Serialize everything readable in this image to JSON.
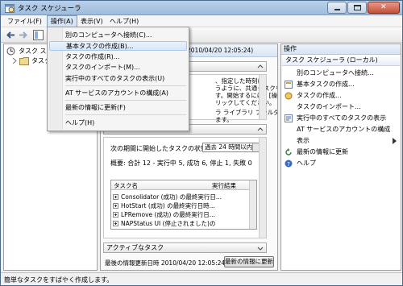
{
  "window": {
    "title": "タスク スケジューラ"
  },
  "menubar": {
    "items": [
      {
        "label": "ファイル(F)"
      },
      {
        "label": "操作(A)"
      },
      {
        "label": "表示(V)"
      },
      {
        "label": "ヘルプ(H)"
      }
    ]
  },
  "dropdown_menu": {
    "items": [
      "別のコンピュータへ接続(C)...",
      "基本タスクの作成(B)...",
      "タスクの作成(R)...",
      "タスクのインポート(M)...",
      "実行中のすべてのタスクの表示(U)",
      "AT サービスのアカウントの構成(A)",
      "最新の情報に更新(F)",
      "ヘルプ(H)"
    ]
  },
  "tree": {
    "root": "タスク スケジューラ",
    "child": "タスク"
  },
  "middle": {
    "header_time": "2010/04/20 12:05:24)",
    "desc_lines": [
      "、指定した時刻に",
      "うように、共通タスクを",
      "す。開始するには、[操",
      "リックしてください。",
      "ラ ライブラリ フォルダに保",
      "ます。"
    ],
    "status_label": "次の期間に開始したタスクの状態:",
    "period_value": "過去 24 時間以内",
    "summary": "概要: 合計 12 - 実行中 5, 成功 6, 停止 1, 失敗 0",
    "table": {
      "columns": [
        "タスク名",
        "実行結果"
      ],
      "rows": [
        "Consolidator (成功) の最終実行日...",
        "HotStart (成功) の最終実行日時...",
        "LPRemove (成功) の最終実行日...",
        "NAPStatus UI (停止されました)の"
      ]
    },
    "active_tasks_label": "アクティブなタスク",
    "last_refresh": "最後の情報更新日時 2010/04/20 12:05:24",
    "refresh_button": "最新の情報に更新"
  },
  "actions": {
    "header": "操作",
    "sub": "タスク スケジューラ (ローカル)",
    "items": [
      {
        "label": "別のコンピュータへ接続...",
        "icon": "none"
      },
      {
        "label": "基本タスクの作成...",
        "icon": "create-basic-task-icon"
      },
      {
        "label": "タスクの作成...",
        "icon": "create-task-icon"
      },
      {
        "label": "タスクのインポート...",
        "icon": "none"
      },
      {
        "label": "実行中のすべてのタスクの表示",
        "icon": "running-tasks-icon"
      },
      {
        "label": "AT サービスのアカウントの構成",
        "icon": "none"
      },
      {
        "label": "表示",
        "icon": "none"
      },
      {
        "label": "最新の情報に更新",
        "icon": "refresh-icon"
      },
      {
        "label": "ヘルプ",
        "icon": "help-icon"
      }
    ]
  },
  "statusbar": {
    "text": "簡単なタスクをすばやく作成します。"
  },
  "colors": {
    "titlebar": "#b9d1ea",
    "menu_highlight": "#d8e7f8"
  }
}
